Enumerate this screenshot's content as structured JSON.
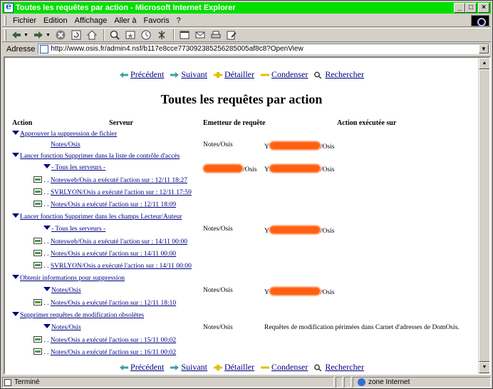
{
  "window": {
    "title": "Toutes les requêtes par action - Microsoft Internet Explorer",
    "controls": {
      "minimize": "_",
      "maximize": "□",
      "close": "×"
    }
  },
  "menu": [
    "Fichier",
    "Edition",
    "Affichage",
    "Aller à",
    "Favoris",
    "?"
  ],
  "toolbar": {
    "icons": [
      "back-icon",
      "forward-icon",
      "stop-icon",
      "refresh-icon",
      "home-icon",
      "search-icon",
      "favorites-icon",
      "history-icon",
      "channels-icon",
      "fullscreen-icon",
      "mail-icon",
      "print-icon",
      "edit-icon"
    ]
  },
  "address": {
    "label": "Adresse",
    "url": "http://www.osis.fr/admin4.nsf/b117e8cce773092385256285005af8c8?OpenView"
  },
  "nav": {
    "prev": "Précédent",
    "next": "Suivant",
    "expand": "Détailler",
    "collapse": "Condenser",
    "search": "Rechercher"
  },
  "page": {
    "title": "Toutes les requêtes par action",
    "columns": {
      "action": "Action",
      "server": "Serveur",
      "sender": "Emetteur de requête",
      "done": "Action exécutée sur"
    }
  },
  "rows": {
    "g1": {
      "label": "Approuver la suppression de fichier"
    },
    "g1s1": {
      "label": "Notes/Osis",
      "sender": "Notes/Osis",
      "done_prefix": "Y",
      "done_suffix": "/Osis"
    },
    "g2": {
      "label": "Lancer fonction Supprimer dans la liste de contrôle d'accès"
    },
    "g2s1": {
      "label": "- Tous les serveurs -",
      "sender_suffix": "/Osis",
      "done_prefix": "Y",
      "done_suffix": "/Osis"
    },
    "g2d1": {
      "label": "Notesweb/Osis a exécuté l'action sur : 12/11 18:27",
      "dots": ". ."
    },
    "g2d2": {
      "label": "SVRLYON/Osis a exécuté l'action sur : 12/11 17:59",
      "dots": ". ."
    },
    "g2d3": {
      "label": "Notes/Osis a exécuté l'action sur : 12/11 18:09",
      "dots": ". ."
    },
    "g3": {
      "label": "Lancer fonction Supprimer dans les champs Lecteur/Auteur"
    },
    "g3s1": {
      "label": "- Tous les serveurs -",
      "sender": "Notes/Osis",
      "done_prefix": "Y",
      "done_suffix": "/Osis"
    },
    "g3d1": {
      "label": "Notesweb/Osis a exécuté l'action sur : 14/11 00:00",
      "dots": ". ."
    },
    "g3d2": {
      "label": "Notes/Osis a exécuté l'action sur : 14/11 00:00",
      "dots": ". ."
    },
    "g3d3": {
      "label": "SVRLYON/Osis a exécuté l'action sur : 14/11 00:00",
      "dots": ". ."
    },
    "g4": {
      "label": "Obtenir informations pour suppression"
    },
    "g4s1": {
      "label": "Notes/Osis",
      "sender": "Notes/Osis",
      "done_prefix": "Y",
      "done_suffix": "/Osis"
    },
    "g4d1": {
      "label": "Notes/Osis a exécuté l'action sur : 12/11 18:10",
      "dots": ". ."
    },
    "g5": {
      "label": "Supprimer requêtes de modification obsolètes"
    },
    "g5s1": {
      "label": "Notes/Osis",
      "sender": "Notes/Osis",
      "done": "Requêtes de modification périmées dans Carnet d'adresses de DomOsis."
    },
    "g5d1": {
      "label": "Notes/Osis a exécuté l'action sur : 15/11 00:02",
      "dots": ". ."
    },
    "g5d2": {
      "label": "Notes/Osis a exécuté l'action sur : 16/11 00:02",
      "dots": ". ."
    }
  },
  "status": {
    "left": "Terminé",
    "zone": "zone Internet"
  },
  "colors": {
    "titlebar": "#00e000",
    "link": "#000080",
    "redaction": "#ff6010"
  }
}
